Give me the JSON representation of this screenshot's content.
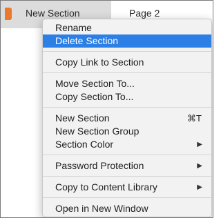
{
  "top": {
    "section_label": "New Section",
    "page_label": "Page 2",
    "accent_color": "#e97a2c"
  },
  "menu": {
    "highlight_color": "#2b7fe5",
    "groups": [
      [
        {
          "label": "Rename"
        },
        {
          "label": "Delete Section",
          "active": true
        }
      ],
      [
        {
          "label": "Copy Link to Section"
        }
      ],
      [
        {
          "label": "Move Section To..."
        },
        {
          "label": "Copy Section To..."
        }
      ],
      [
        {
          "label": "New Section",
          "shortcut": "⌘T"
        },
        {
          "label": "New Section Group"
        },
        {
          "label": "Section Color",
          "submenu": true,
          "arrow_icon": "triangle-right-icon"
        }
      ],
      [
        {
          "label": "Password Protection",
          "submenu": true,
          "arrow_icon": "triangle-right-icon"
        }
      ],
      [
        {
          "label": "Copy to Content Library",
          "submenu": true,
          "arrow_icon": "triangle-right-icon"
        }
      ],
      [
        {
          "label": "Open in New Window"
        }
      ]
    ]
  }
}
